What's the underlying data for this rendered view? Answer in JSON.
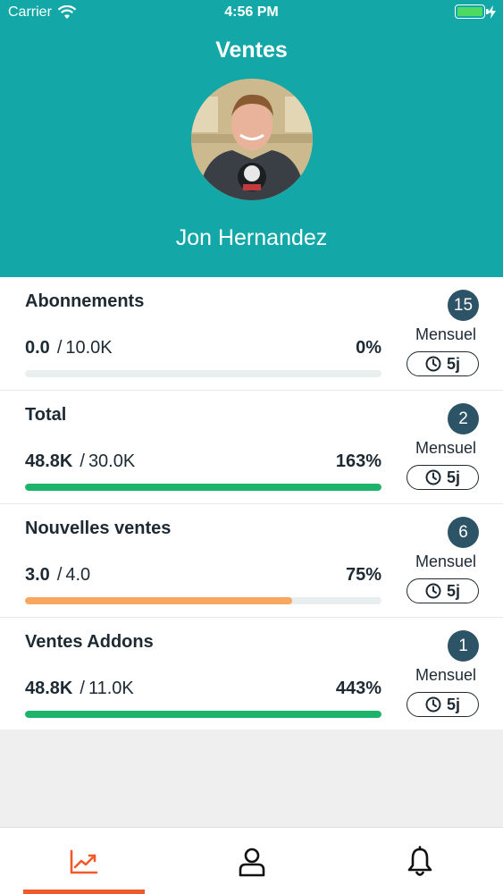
{
  "status_bar": {
    "carrier": "Carrier",
    "time": "4:56 PM"
  },
  "header": {
    "title": "Ventes",
    "user_name": "Jon Hernandez"
  },
  "colors": {
    "header_bg": "#13a8a7",
    "badge_bg": "#2c5466",
    "progress_green": "#1db36b",
    "progress_orange": "#f7a85e",
    "tab_active": "#f05a2b"
  },
  "cards": [
    {
      "title": "Abonnements",
      "current": "0.0",
      "target": "10.0K",
      "percent": "0%",
      "progress": 0,
      "progress_color": "#1db36b",
      "count": "15",
      "period": "Mensuel",
      "days": "5j"
    },
    {
      "title": "Total",
      "current": "48.8K",
      "target": "30.0K",
      "percent": "163%",
      "progress": 1,
      "progress_color": "#1db36b",
      "count": "2",
      "period": "Mensuel",
      "days": "5j"
    },
    {
      "title": "Nouvelles ventes",
      "current": "3.0",
      "target": "4.0",
      "percent": "75%",
      "progress": 0.75,
      "progress_color": "#f7a85e",
      "count": "6",
      "period": "Mensuel",
      "days": "5j"
    },
    {
      "title": "Ventes Addons",
      "current": "48.8K",
      "target": "11.0K",
      "percent": "443%",
      "progress": 1,
      "progress_color": "#1db36b",
      "count": "1",
      "period": "Mensuel",
      "days": "5j"
    }
  ],
  "tabs": [
    {
      "icon": "trend-chart-icon",
      "active": true
    },
    {
      "icon": "user-icon",
      "active": false
    },
    {
      "icon": "bell-icon",
      "active": false
    }
  ]
}
